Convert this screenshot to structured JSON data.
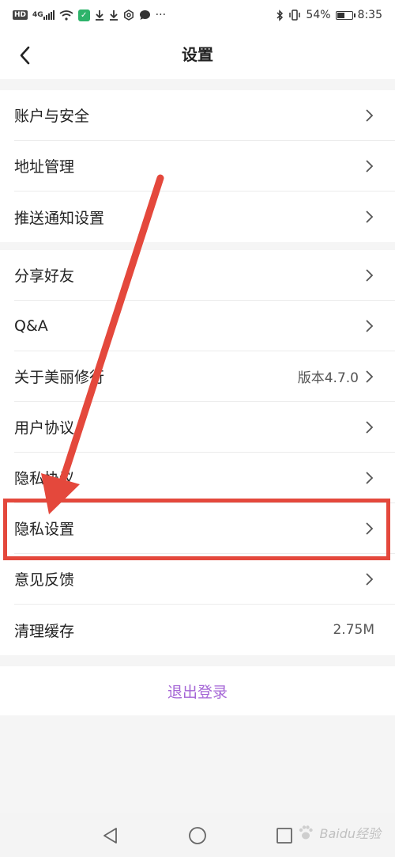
{
  "status_bar": {
    "left_icons": [
      "hd-icon",
      "signal-4g-icon",
      "wifi-icon",
      "app-shield-icon",
      "download-icon",
      "download-icon",
      "settings-icon",
      "chat-icon",
      "more-icon"
    ],
    "hd_label": "HD",
    "network_label": "4G",
    "more_label": "···",
    "battery_percent": "54%",
    "battery_level": 0.54,
    "time": "8:35"
  },
  "navbar": {
    "title": "设置"
  },
  "group1": {
    "items": [
      {
        "label": "账户与安全"
      },
      {
        "label": "地址管理"
      },
      {
        "label": "推送通知设置"
      }
    ]
  },
  "group2": {
    "items": [
      {
        "label": "分享好友"
      },
      {
        "label": "Q&A"
      },
      {
        "label": "关于美丽修行",
        "value": "版本4.7.0"
      },
      {
        "label": "用户协议"
      },
      {
        "label": "隐私协议"
      },
      {
        "label": "隐私设置"
      },
      {
        "label": "意见反馈"
      },
      {
        "label": "清理缓存",
        "value": "2.75M"
      }
    ]
  },
  "logout": {
    "label": "退出登录"
  },
  "colors": {
    "accent": "#a566d6",
    "annotation": "#e4483c"
  },
  "watermark": {
    "label": "Baidu经验"
  }
}
